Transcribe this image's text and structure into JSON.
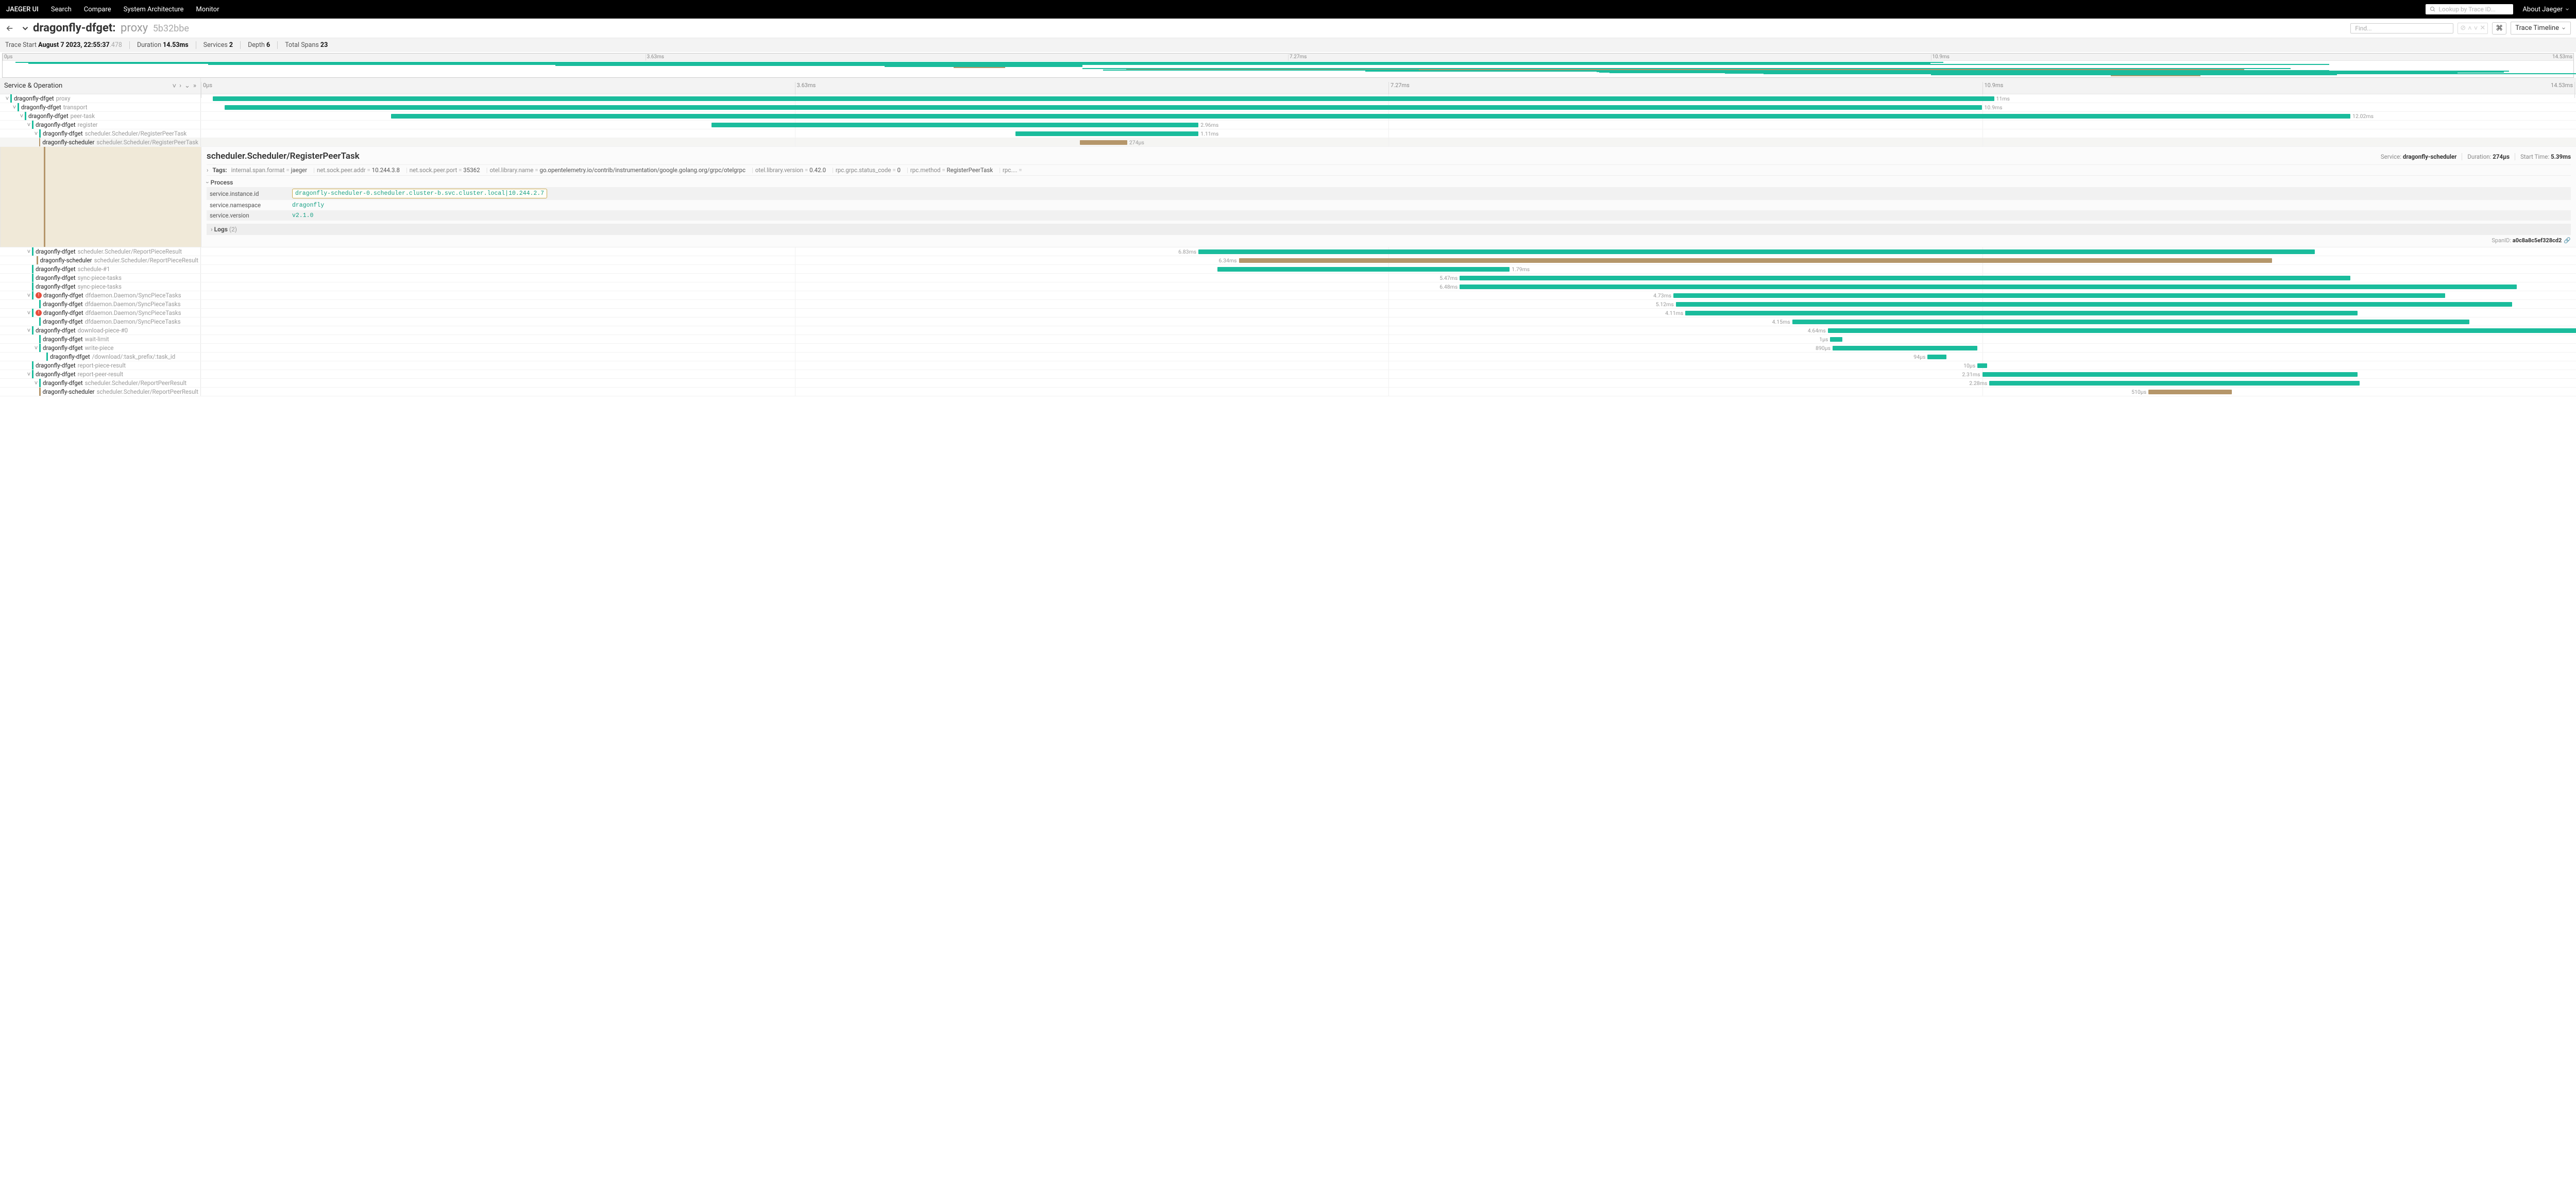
{
  "nav": {
    "brand": "JAEGER UI",
    "links": [
      "Search",
      "Compare",
      "System Architecture",
      "Monitor"
    ],
    "lookup_placeholder": "Lookup by Trace ID...",
    "about": "About Jaeger"
  },
  "header": {
    "service": "dragonfly-dfget:",
    "operation": "proxy",
    "trace_hash": "5b32bbe",
    "find_placeholder": "Find...",
    "timeline_label": "Trace Timeline"
  },
  "stats": {
    "start_label": "Trace Start",
    "start_value": "August 7 2023, 22:55:37",
    "start_ms": ".478",
    "duration_label": "Duration",
    "duration_value": "14.53ms",
    "services_label": "Services",
    "services_value": "2",
    "depth_label": "Depth",
    "depth_value": "6",
    "spans_label": "Total Spans",
    "spans_value": "23"
  },
  "ticks": [
    "0µs",
    "3.63ms",
    "7.27ms",
    "10.9ms",
    "14.53ms"
  ],
  "tree_header": "Service & Operation",
  "rows": [
    {
      "indent": 0,
      "caret": true,
      "color": "teal",
      "svc": "dragonfly-dfget",
      "op": "proxy",
      "bar": {
        "l": 0.5,
        "w": 75,
        "c": "teal"
      },
      "dur": "11ms",
      "durSide": "r"
    },
    {
      "indent": 1,
      "caret": true,
      "color": "teal",
      "svc": "dragonfly-dfget",
      "op": "transport",
      "bar": {
        "l": 1,
        "w": 74,
        "c": "teal"
      },
      "dur": "10.9ms",
      "durSide": "r"
    },
    {
      "indent": 2,
      "caret": true,
      "color": "teal",
      "svc": "dragonfly-dfget",
      "op": "peer-task",
      "bar": {
        "l": 8,
        "w": 82.5,
        "c": "teal"
      },
      "dur": "12.02ms",
      "durSide": "r"
    },
    {
      "indent": 3,
      "caret": true,
      "color": "teal",
      "svc": "dragonfly-dfget",
      "op": "register",
      "bar": {
        "l": 21.5,
        "w": 20.5,
        "c": "teal"
      },
      "dur": "2.96ms",
      "durSide": "r"
    },
    {
      "indent": 4,
      "caret": true,
      "color": "teal",
      "svc": "dragonfly-dfget",
      "op": "scheduler.Scheduler/RegisterPeerTask",
      "bar": {
        "l": 34.3,
        "w": 7.7,
        "c": "teal"
      },
      "dur": "1.11ms",
      "durSide": "r"
    },
    {
      "indent": 5,
      "caret": false,
      "color": "brown",
      "svc": "dragonfly-scheduler",
      "op": "scheduler.Scheduler/RegisterPeerTask",
      "bar": {
        "l": 37,
        "w": 2,
        "c": "brown"
      },
      "dur": "274µs",
      "durSide": "r",
      "sel": true
    }
  ],
  "detail": {
    "title": "scheduler.Scheduler/RegisterPeerTask",
    "service_label": "Service:",
    "service": "dragonfly-scheduler",
    "duration_label": "Duration:",
    "duration": "274µs",
    "start_label": "Start Time:",
    "start": "5.39ms",
    "tags_label": "Tags:",
    "tags": [
      {
        "k": "internal.span.format",
        "v": "jaeger"
      },
      {
        "k": "net.sock.peer.addr",
        "v": "10.244.3.8"
      },
      {
        "k": "net.sock.peer.port",
        "v": "35362"
      },
      {
        "k": "otel.library.name",
        "v": "go.opentelemetry.io/contrib/instrumentation/google.golang.org/grpc/otelgrpc"
      },
      {
        "k": "otel.library.version",
        "v": "0.42.0"
      },
      {
        "k": "rpc.grpc.status_code",
        "v": "0"
      },
      {
        "k": "rpc.method",
        "v": "RegisterPeerTask"
      },
      {
        "k": "rpc....",
        "v": ""
      }
    ],
    "process_label": "Process",
    "process": [
      {
        "k": "service.instance.id",
        "v": "dragonfly-scheduler-0.scheduler.cluster-b.svc.cluster.local|10.244.2.7",
        "hl": true
      },
      {
        "k": "service.namespace",
        "v": "dragonfly"
      },
      {
        "k": "service.version",
        "v": "v2.1.0"
      }
    ],
    "logs_label": "Logs",
    "logs_count": "(2)",
    "spanid_label": "SpanID:",
    "spanid": "a0c8a8c5ef328cd2"
  },
  "rows2": [
    {
      "indent": 3,
      "caret": true,
      "color": "teal",
      "svc": "dragonfly-dfget",
      "op": "scheduler.Scheduler/ReportPieceResult",
      "bar": {
        "l": 42,
        "w": 47,
        "c": "teal"
      },
      "dur": "6.83ms",
      "durSide": "l"
    },
    {
      "indent": 4,
      "caret": false,
      "color": "brown",
      "svc": "dragonfly-scheduler",
      "op": "scheduler.Scheduler/ReportPieceResult",
      "bar": {
        "l": 43.7,
        "w": 43.5,
        "c": "brown"
      },
      "dur": "6.34ms",
      "durSide": "l"
    },
    {
      "indent": 3,
      "caret": false,
      "color": "teal",
      "svc": "dragonfly-dfget",
      "op": "schedule-#1",
      "bar": {
        "l": 42.8,
        "w": 12.3,
        "c": "teal"
      },
      "dur": "1.79ms",
      "durSide": "r"
    },
    {
      "indent": 3,
      "caret": false,
      "color": "teal",
      "svc": "dragonfly-dfget",
      "op": "sync-piece-tasks",
      "bar": {
        "l": 53,
        "w": 37.5,
        "c": "teal"
      },
      "dur": "5.47ms",
      "durSide": "l"
    },
    {
      "indent": 3,
      "caret": false,
      "color": "teal",
      "svc": "dragonfly-dfget",
      "op": "sync-piece-tasks",
      "bar": {
        "l": 53,
        "w": 44.5,
        "c": "teal"
      },
      "dur": "6.48ms",
      "durSide": "l"
    },
    {
      "indent": 3,
      "caret": true,
      "color": "teal",
      "err": true,
      "svc": "dragonfly-dfget",
      "op": "dfdaemon.Daemon/SyncPieceTasks",
      "bar": {
        "l": 62,
        "w": 32.5,
        "c": "teal"
      },
      "dur": "4.73ms",
      "durSide": "l"
    },
    {
      "indent": 4,
      "caret": false,
      "color": "teal",
      "svc": "dragonfly-dfget",
      "op": "dfdaemon.Daemon/SyncPieceTasks",
      "bar": {
        "l": 62.1,
        "w": 35.2,
        "c": "teal"
      },
      "dur": "5.12ms",
      "durSide": "l"
    },
    {
      "indent": 3,
      "caret": true,
      "color": "teal",
      "err": true,
      "svc": "dragonfly-dfget",
      "op": "dfdaemon.Daemon/SyncPieceTasks",
      "bar": {
        "l": 62.5,
        "w": 28.3,
        "c": "teal"
      },
      "dur": "4.11ms",
      "durSide": "l"
    },
    {
      "indent": 4,
      "caret": false,
      "color": "teal",
      "svc": "dragonfly-dfget",
      "op": "dfdaemon.Daemon/SyncPieceTasks",
      "bar": {
        "l": 67,
        "w": 28.5,
        "c": "teal"
      },
      "dur": "4.15ms",
      "durSide": "l"
    },
    {
      "indent": 3,
      "caret": true,
      "color": "teal",
      "svc": "dragonfly-dfget",
      "op": "download-piece-#0",
      "bar": {
        "l": 68.5,
        "w": 32,
        "c": "teal"
      },
      "dur": "4.64ms",
      "durSide": "l"
    },
    {
      "indent": 4,
      "caret": false,
      "color": "teal",
      "svc": "dragonfly-dfget",
      "op": "wait-limit",
      "bar": {
        "l": 68.6,
        "w": 0.5,
        "c": "teal"
      },
      "dur": "1µs",
      "durSide": "l"
    },
    {
      "indent": 4,
      "caret": true,
      "color": "teal",
      "svc": "dragonfly-dfget",
      "op": "write-piece",
      "bar": {
        "l": 68.7,
        "w": 6.1,
        "c": "teal"
      },
      "dur": "890µs",
      "durSide": "l"
    },
    {
      "indent": 5,
      "caret": false,
      "color": "teal",
      "svc": "dragonfly-dfget",
      "op": "/download/:task_prefix/:task_id",
      "bar": {
        "l": 72.7,
        "w": 0.8,
        "c": "teal"
      },
      "dur": "94µs",
      "durSide": "l"
    },
    {
      "indent": 3,
      "caret": false,
      "color": "teal",
      "svc": "dragonfly-dfget",
      "op": "report-piece-result",
      "bar": {
        "l": 74.8,
        "w": 0.4,
        "c": "teal"
      },
      "dur": "10µs",
      "durSide": "l"
    },
    {
      "indent": 3,
      "caret": true,
      "color": "teal",
      "svc": "dragonfly-dfget",
      "op": "report-peer-result",
      "bar": {
        "l": 75,
        "w": 15.8,
        "c": "teal"
      },
      "dur": "2.31ms",
      "durSide": "l"
    },
    {
      "indent": 4,
      "caret": true,
      "color": "teal",
      "svc": "dragonfly-dfget",
      "op": "scheduler.Scheduler/ReportPeerResult",
      "bar": {
        "l": 75.3,
        "w": 15.6,
        "c": "teal"
      },
      "dur": "2.28ms",
      "durSide": "l"
    },
    {
      "indent": 5,
      "caret": false,
      "color": "brown",
      "svc": "dragonfly-scheduler",
      "op": "scheduler.Scheduler/ReportPeerResult",
      "bar": {
        "l": 82,
        "w": 3.5,
        "c": "brown"
      },
      "dur": "510µs",
      "durSide": "l"
    }
  ],
  "minimap_bars": [
    {
      "l": 0.5,
      "w": 75,
      "t": 2,
      "c": "teal"
    },
    {
      "l": 1,
      "w": 74,
      "t": 4,
      "c": "teal"
    },
    {
      "l": 8,
      "w": 82.5,
      "t": 6,
      "c": "teal"
    },
    {
      "l": 21.5,
      "w": 20.5,
      "t": 8,
      "c": "teal"
    },
    {
      "l": 34.3,
      "w": 7.7,
      "t": 10,
      "c": "teal"
    },
    {
      "l": 37,
      "w": 2,
      "t": 12,
      "c": "brown"
    },
    {
      "l": 42,
      "w": 47,
      "t": 14,
      "c": "teal"
    },
    {
      "l": 43.7,
      "w": 43.5,
      "t": 16,
      "c": "brown"
    },
    {
      "l": 42.8,
      "w": 12.3,
      "t": 17,
      "c": "teal"
    },
    {
      "l": 53,
      "w": 37.5,
      "t": 18,
      "c": "teal"
    },
    {
      "l": 53,
      "w": 44.5,
      "t": 19,
      "c": "teal"
    },
    {
      "l": 62,
      "w": 32.5,
      "t": 20,
      "c": "teal"
    },
    {
      "l": 62.1,
      "w": 35.2,
      "t": 21,
      "c": "teal"
    },
    {
      "l": 62.5,
      "w": 28.3,
      "t": 22,
      "c": "teal"
    },
    {
      "l": 67,
      "w": 28.5,
      "t": 23,
      "c": "teal"
    },
    {
      "l": 68.5,
      "w": 32,
      "t": 24,
      "c": "teal"
    },
    {
      "l": 75,
      "w": 15.8,
      "t": 26,
      "c": "teal"
    },
    {
      "l": 82,
      "w": 3.5,
      "t": 28,
      "c": "brown"
    }
  ]
}
